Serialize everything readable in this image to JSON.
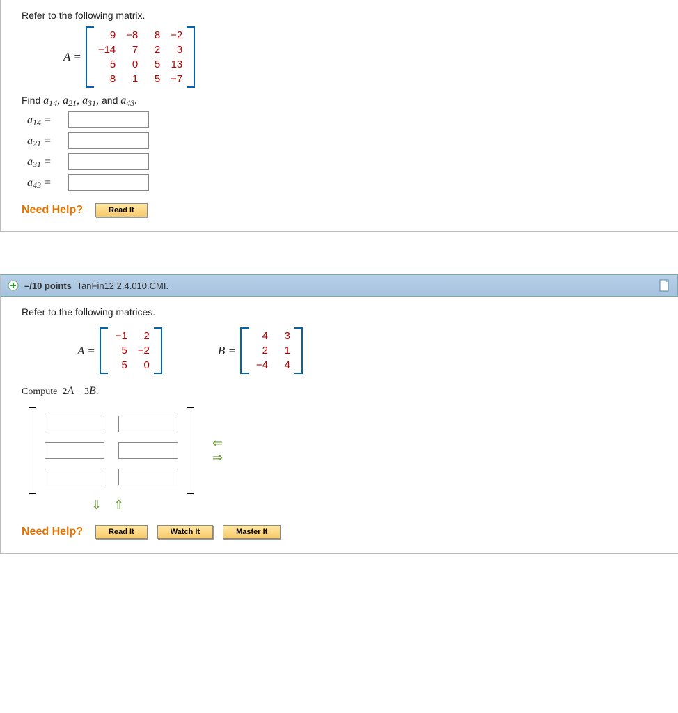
{
  "q1": {
    "prompt": "Refer to the following matrix.",
    "matrixLabel": "A =",
    "matrixA": [
      [
        "9",
        "−8",
        "8",
        "−2"
      ],
      [
        "−14",
        "7",
        "2",
        "3"
      ],
      [
        "5",
        "0",
        "5",
        "13"
      ],
      [
        "8",
        "1",
        "5",
        "−7"
      ]
    ],
    "findLine_pre": "Find  ",
    "findLine_items": "a14, a21, a31,",
    "findLine_and": " and ",
    "findLine_last": "a43.",
    "labels": {
      "a14": "a14 =",
      "a21": "a21 =",
      "a31": "a31 =",
      "a43": "a43 ="
    },
    "needHelp": "Need Help?",
    "readIt": "Read It"
  },
  "q2": {
    "pointsPrefix": "–/10 points",
    "source": "TanFin12 2.4.010.CMI.",
    "prompt": "Refer to the following matrices.",
    "labelA": "A =",
    "labelB": "B =",
    "matrixA": [
      [
        "−1",
        "2"
      ],
      [
        "5",
        "−2"
      ],
      [
        "5",
        "0"
      ]
    ],
    "matrixB": [
      [
        "4",
        "3"
      ],
      [
        "2",
        "1"
      ],
      [
        "−4",
        "4"
      ]
    ],
    "compute": "Compute  2A − 3B.",
    "needHelp": "Need Help?",
    "readIt": "Read It",
    "watchIt": "Watch It",
    "masterIt": "Master It"
  },
  "chart_data": null
}
